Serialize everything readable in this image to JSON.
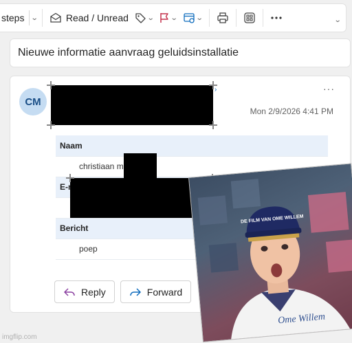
{
  "toolbar": {
    "steps_label": "steps",
    "read_unread_label": "Read / Unread"
  },
  "email": {
    "subject": "Nieuwe informatie aanvraag geluidsinstallatie",
    "avatar_initials": "CM",
    "date": "Mon 2/9/2026 4:41 PM",
    "more": "···"
  },
  "form": {
    "rows": [
      {
        "header": "Naam",
        "value": "christiaan m"
      },
      {
        "header": "E-r",
        "value": ""
      },
      {
        "header": "Bericht",
        "value": "poep"
      }
    ]
  },
  "actions": {
    "reply_label": "Reply",
    "forward_label": "Forward"
  },
  "overlay": {
    "cap_text": "DE FILM VAN OME WILLEM",
    "shirt_text": "Ome Willem"
  },
  "watermark": "imgflip.com"
}
